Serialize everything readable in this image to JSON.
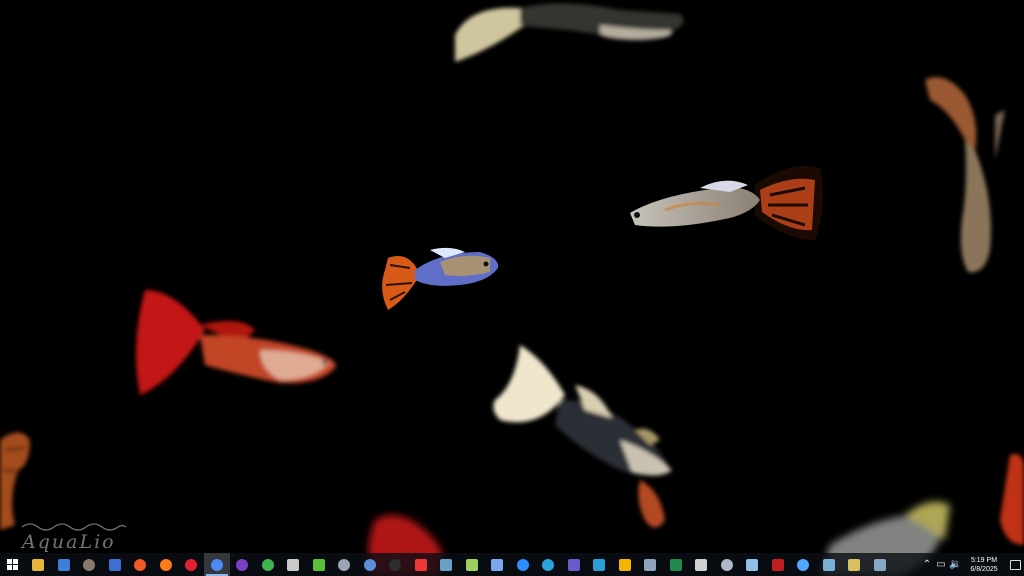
{
  "desktop": {
    "wallpaper": "aquarium-guppies",
    "background_color": "#000000",
    "watermark_text": "AquaLio"
  },
  "taskbar": {
    "background": "#0a0e14",
    "start_icon": "windows-start-icon",
    "apps": [
      {
        "name": "file-explorer-icon",
        "color": "#e8b53c"
      },
      {
        "name": "store-icon",
        "color": "#3d7fd6"
      },
      {
        "name": "gimp-icon",
        "color": "#8a7a6a"
      },
      {
        "name": "vpn-lock-icon",
        "color": "#3c6fd0"
      },
      {
        "name": "brave-icon",
        "color": "#f05a28"
      },
      {
        "name": "firefox-icon",
        "color": "#ff7a1a"
      },
      {
        "name": "opera-icon",
        "color": "#e2202f"
      },
      {
        "name": "chrome-icon",
        "color": "#4c8bf5"
      },
      {
        "name": "github-icon",
        "color": "#7b3fc6"
      },
      {
        "name": "sync-icon",
        "color": "#3fb34f"
      },
      {
        "name": "cloud-app-icon",
        "color": "#c9c9c9"
      },
      {
        "name": "camtasia-icon",
        "color": "#5bbf3a"
      },
      {
        "name": "search-app-icon",
        "color": "#9aa4b4"
      },
      {
        "name": "browser-b-icon",
        "color": "#5d8fd8"
      },
      {
        "name": "clock-app-icon",
        "color": "#2d2d2d"
      },
      {
        "name": "vivaldi-icon",
        "color": "#ef3939"
      },
      {
        "name": "device-app-icon",
        "color": "#6aa0c8"
      },
      {
        "name": "notes-app-icon",
        "color": "#9ed060"
      },
      {
        "name": "filter-app-icon",
        "color": "#7aa7f0"
      },
      {
        "name": "zoom-icon",
        "color": "#2d8cff"
      },
      {
        "name": "telegram-icon",
        "color": "#2aa3e0"
      },
      {
        "name": "grid-app-icon",
        "color": "#6a5acd"
      },
      {
        "name": "vscode-icon",
        "color": "#2a9fd6"
      },
      {
        "name": "docs-icon",
        "color": "#f4b400"
      },
      {
        "name": "pin-app-icon",
        "color": "#8fa3bf"
      },
      {
        "name": "excel-icon",
        "color": "#1f8a4c"
      },
      {
        "name": "inkscape-icon",
        "color": "#d0d0d0"
      },
      {
        "name": "magnifier-app-icon",
        "color": "#b0b8c8"
      },
      {
        "name": "network-app-icon",
        "color": "#8fc1e8"
      },
      {
        "name": "filezilla-icon",
        "color": "#bf1f1f"
      },
      {
        "name": "onedrive-icon",
        "color": "#4fa8ff"
      },
      {
        "name": "package-app-icon",
        "color": "#7ab0d8"
      },
      {
        "name": "paint-app-icon",
        "color": "#d8c060"
      },
      {
        "name": "monitor-app-icon",
        "color": "#88a8c8"
      }
    ],
    "active_index": 7,
    "tray": {
      "chevron_icon": "chevron-up-icon",
      "network_icon": "network-icon",
      "volume_icon": "volume-icon",
      "time": "5:19 PM",
      "date": "6/8/2025",
      "notification_icon": "notification-icon"
    }
  }
}
